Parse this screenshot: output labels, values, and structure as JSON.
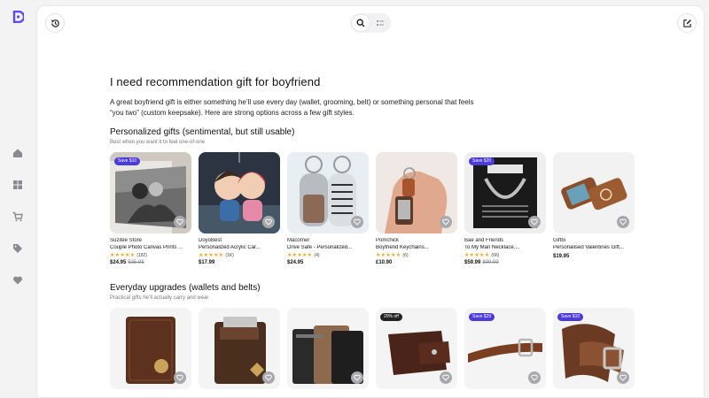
{
  "colors": {
    "accent": "#5b4bf5",
    "badge": "#4b3bd8",
    "badge_dark": "#222222",
    "star": "#f5a623"
  },
  "rail": {
    "logo_icon": "perplexity-style-logo-icon",
    "items": [
      {
        "name": "home",
        "icon": "home-icon"
      },
      {
        "name": "apps",
        "icon": "grid-icon"
      },
      {
        "name": "cart",
        "icon": "cart-icon"
      },
      {
        "name": "tags",
        "icon": "tag-icon"
      },
      {
        "name": "favorites",
        "icon": "heart-icon"
      }
    ]
  },
  "topbar": {
    "history_icon": "history-icon",
    "search_icon": "search-icon",
    "list_icon": "list-icon",
    "compose_icon": "compose-icon"
  },
  "query": "I need recommendation gift for boyfriend",
  "intro": "A great boyfriend gift is either something he’ll use every day (wallet, grooming, belt) or something personal that feels “you two” (custom keepsake). Here are strong options across a few gift styles.",
  "sections": [
    {
      "title": "Personalized gifts (sentimental, but still usable)",
      "subtitle": "Best when you want it to feel one-of-one",
      "products": [
        {
          "store": "Suzitee Store",
          "title": "Couple Photo Canvas Prints ...",
          "rating": "(182)",
          "price": "$24.95",
          "original": "$35.95",
          "badge": "Save $10"
        },
        {
          "store": "DoyoBest",
          "title": "Personalized Acrylic Car...",
          "rating": "(1K)",
          "price": "$17.99",
          "original": "",
          "badge": ""
        },
        {
          "store": "Macorner",
          "title": "Drive Safe - Personalized...",
          "rating": "(4)",
          "price": "$24.95",
          "original": "",
          "badge": ""
        },
        {
          "store": "Pomchick",
          "title": "Boyfriend Keychains...",
          "rating": "(6)",
          "price": "£10.90",
          "original": "",
          "badge": ""
        },
        {
          "store": "Bae and Friends",
          "title": "To My Man Necklace,...",
          "rating": "(66)",
          "price": "$59.99",
          "original": "$99.99",
          "badge": "Save $20"
        },
        {
          "store": "Giftbi",
          "title": "Personalised Valentines Gift...",
          "rating": "",
          "price": "$19.95",
          "original": "",
          "badge": ""
        }
      ]
    },
    {
      "title": "Everyday upgrades (wallets and belts)",
      "subtitle": "Practical gifts he’ll actually carry and wear",
      "products": [
        {
          "badge": ""
        },
        {
          "badge": ""
        },
        {
          "badge": ""
        },
        {
          "badge": "20% off"
        },
        {
          "badge": "Save $29"
        },
        {
          "badge": "Save $10"
        }
      ]
    }
  ]
}
